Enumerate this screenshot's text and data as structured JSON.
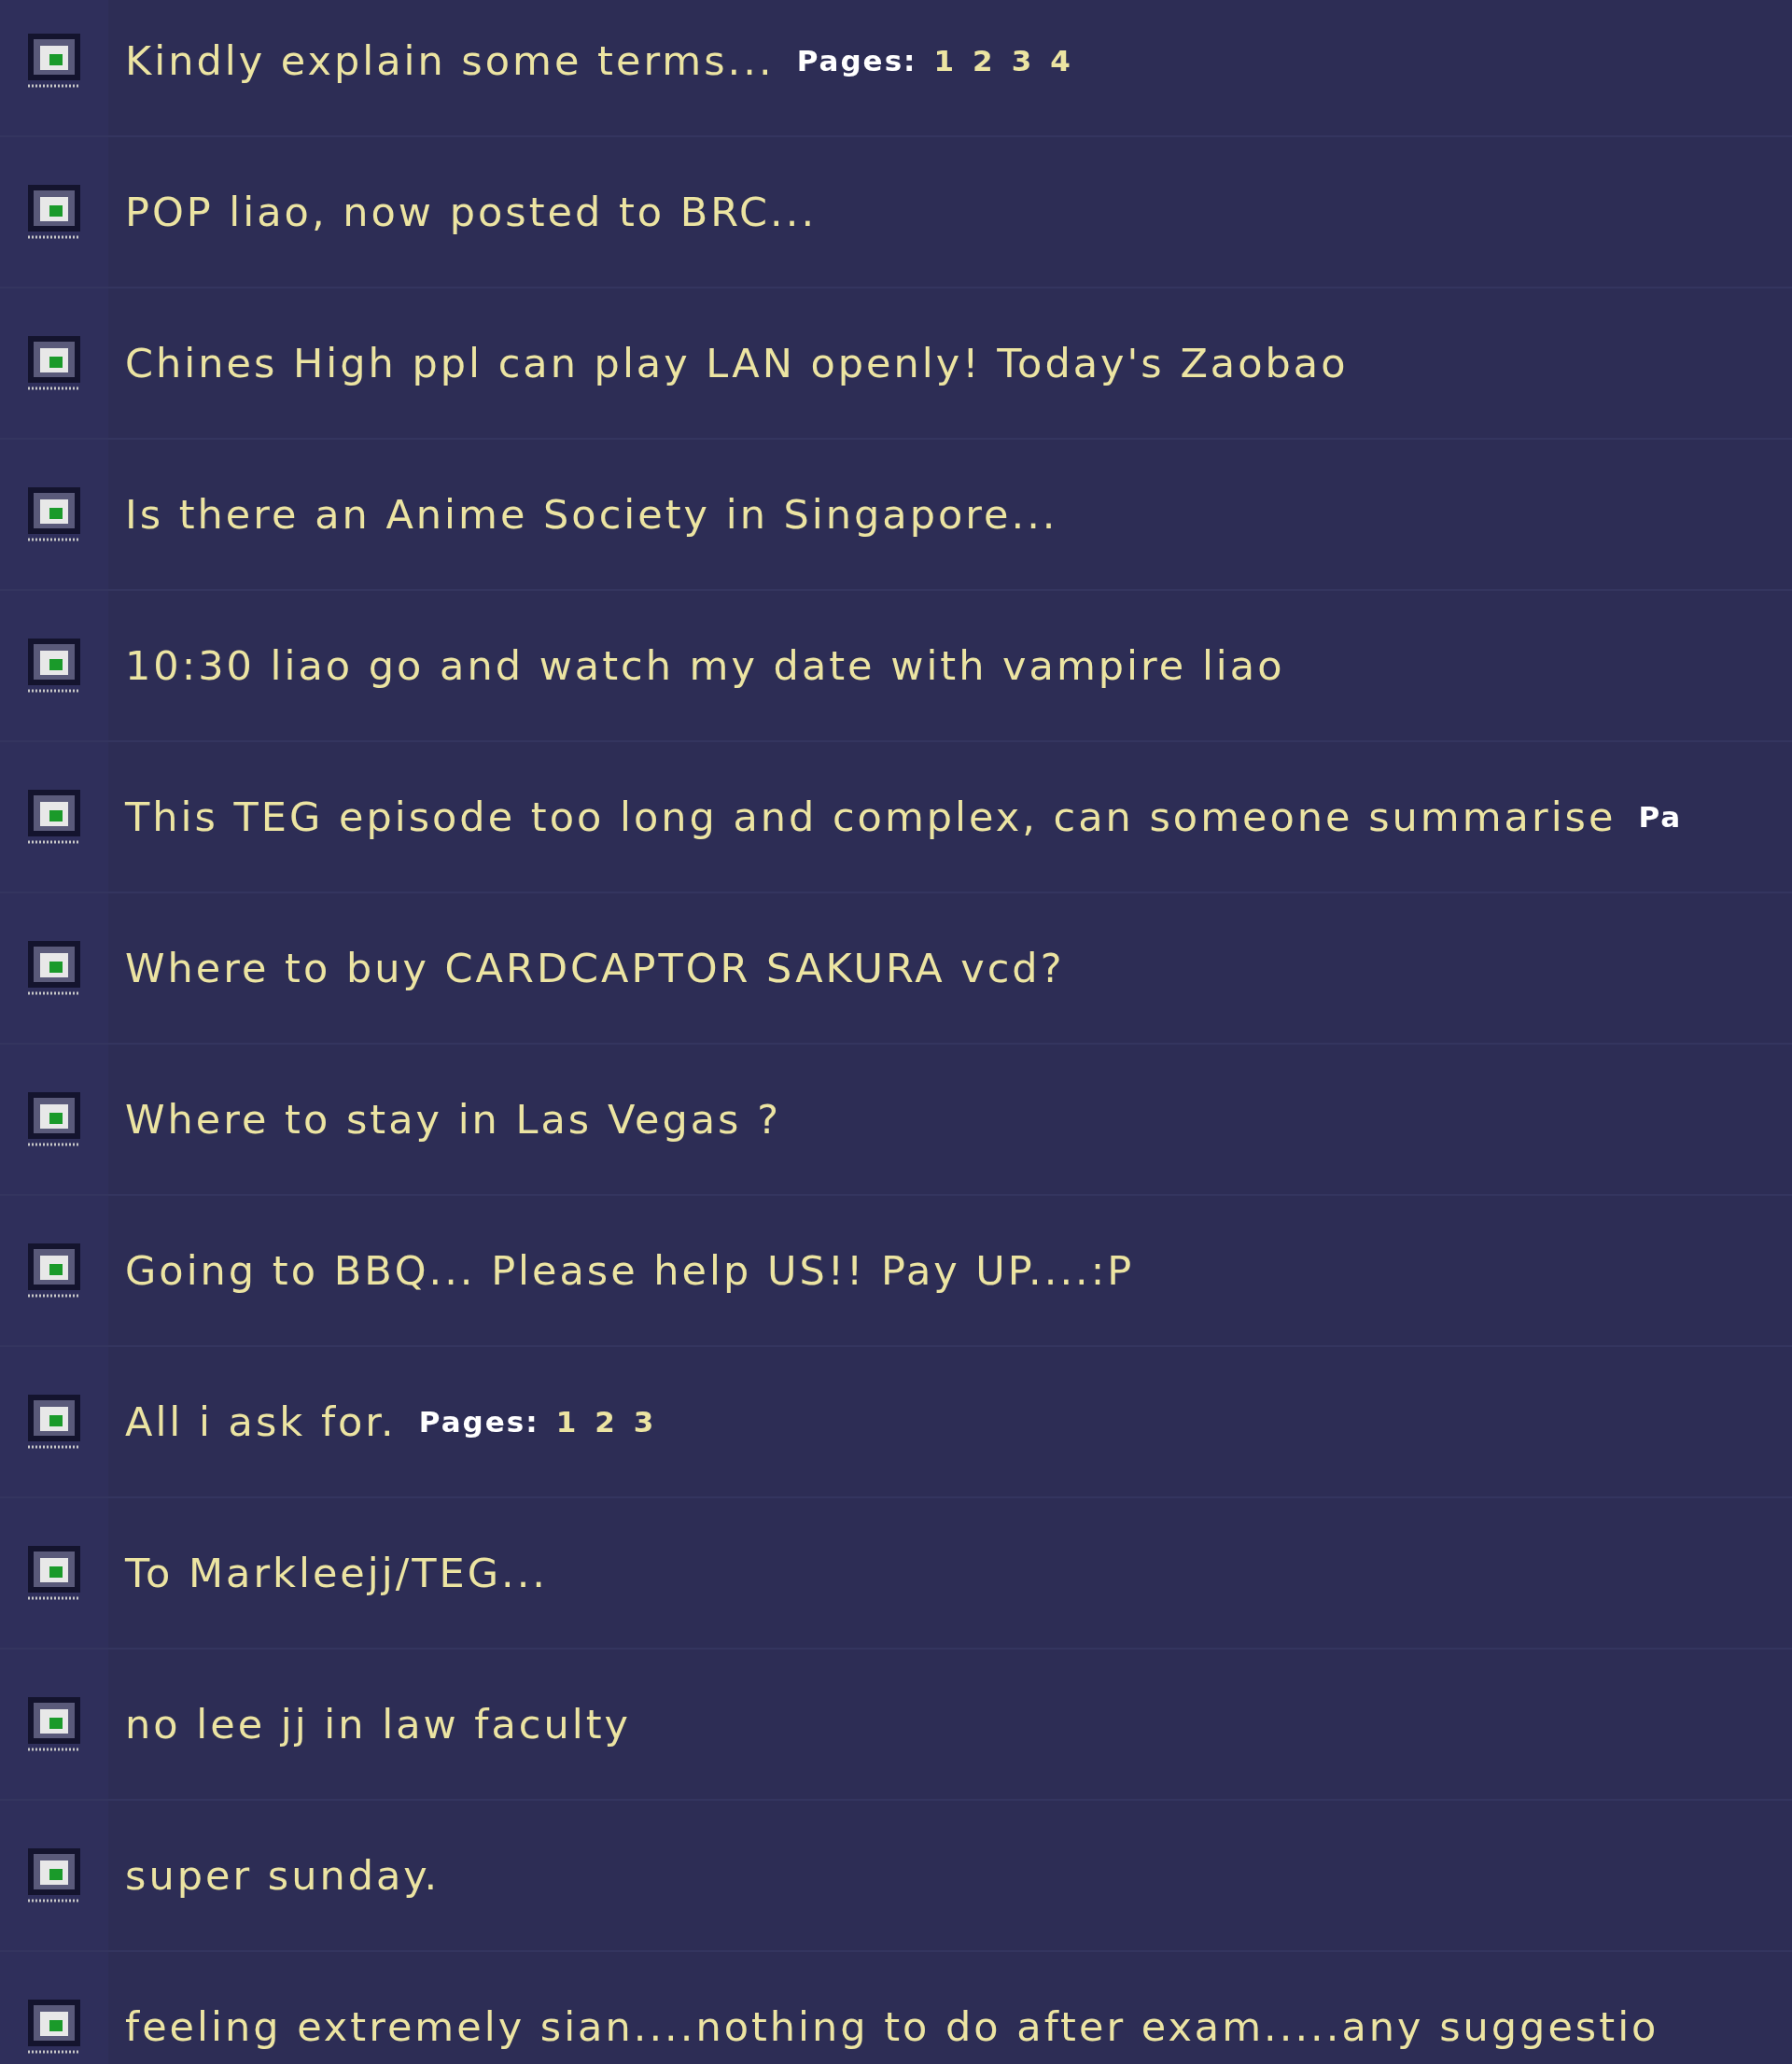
{
  "topics": [
    {
      "title": "Kindly explain some terms...",
      "pages": {
        "label": "Pages:",
        "numbers": [
          "1",
          "2",
          "3",
          "4"
        ]
      }
    },
    {
      "title": "POP liao, now posted to BRC..."
    },
    {
      "title": "Chines High ppl can play LAN openly! Today's Zaobao"
    },
    {
      "title": "Is there an Anime Society in Singapore..."
    },
    {
      "title": "10:30 liao go and watch my date with vampire liao"
    },
    {
      "title": "This TEG episode too long and complex, can someone summarise",
      "pages": {
        "label": "Pa"
      }
    },
    {
      "title": "Where to buy CARDCAPTOR SAKURA vcd?"
    },
    {
      "title": "Where to stay in Las Vegas ?"
    },
    {
      "title": "Going to BBQ... Please help US!! Pay UP....:P"
    },
    {
      "title": "All i ask for.",
      "pages": {
        "label": "Pages:",
        "numbers": [
          "1",
          "2",
          "3"
        ]
      }
    },
    {
      "title": "To Markleejj/TEG..."
    },
    {
      "title": "no lee jj in law faculty"
    },
    {
      "title": "super sunday."
    },
    {
      "title": "feeling extremely sian....nothing to do after exam.....any suggestio"
    }
  ]
}
